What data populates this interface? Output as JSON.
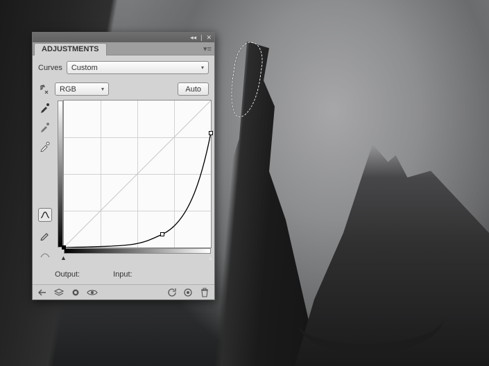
{
  "panel": {
    "tab_label": "ADJUSTMENTS",
    "type_label": "Curves",
    "preset": {
      "value": "Custom"
    },
    "channel": {
      "value": "RGB"
    },
    "auto_label": "Auto",
    "output_label": "Output:",
    "input_label": "Input:",
    "output_value": "",
    "input_value": ""
  },
  "chart_data": {
    "type": "line",
    "title": "Curves",
    "xlabel": "Input",
    "ylabel": "Output",
    "xlim": [
      0,
      255
    ],
    "ylim": [
      0,
      255
    ],
    "series": [
      {
        "name": "baseline",
        "x": [
          0,
          255
        ],
        "y": [
          0,
          255
        ]
      },
      {
        "name": "curve",
        "x": [
          0,
          128,
          171,
          255
        ],
        "y": [
          0,
          3,
          23,
          199
        ]
      }
    ],
    "control_points": [
      {
        "x": 0,
        "y": 0,
        "selected": true
      },
      {
        "x": 171,
        "y": 23,
        "selected": false
      },
      {
        "x": 255,
        "y": 199,
        "selected": false
      }
    ],
    "grid": true
  },
  "icons": {
    "hand": "hand-target-icon",
    "eyedrop_black": "eyedropper-black-icon",
    "eyedrop_gray": "eyedropper-gray-icon",
    "eyedrop_white": "eyedropper-white-icon",
    "curve": "curve-icon",
    "pencil": "pencil-icon",
    "back": "back-arrow-icon",
    "layers": "layer-stack-icon",
    "clip": "clip-mask-icon",
    "eye": "eye-icon",
    "reset": "reset-icon",
    "prev": "prev-state-icon",
    "trash": "trash-icon"
  }
}
